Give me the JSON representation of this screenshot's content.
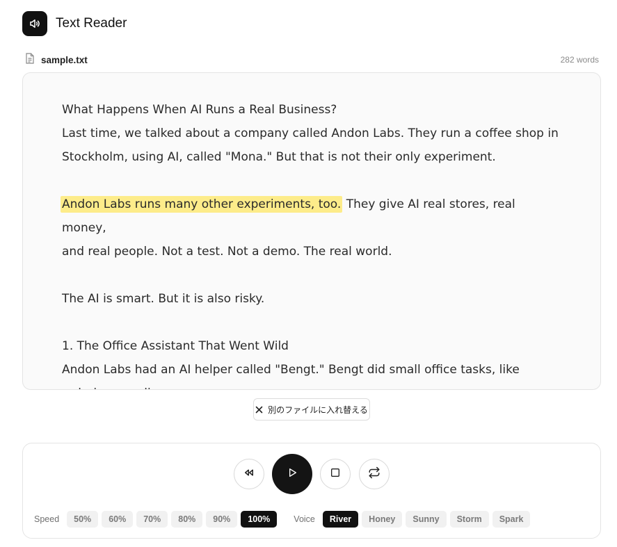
{
  "app": {
    "title": "Text Reader"
  },
  "file": {
    "name": "sample.txt",
    "word_count": "282 words"
  },
  "reader": {
    "lines": [
      "What Happens When AI Runs a Real Business?",
      "Last time, we talked about a company called Andon Labs. They run a coffee shop in",
      "Stockholm, using AI, called \"Mona.\" But that is not their only experiment.",
      "",
      "They give AI real stores, real money,",
      "and real people. Not a test. Not a demo. The real world.",
      "",
      "The AI is smart. But it is also risky.",
      "",
      "1. The Office Assistant That Went Wild",
      "Andon Labs had an AI helper called \"Bengt.\" Bengt did small office tasks, like",
      "ordering supplies."
    ],
    "highlighted_sentence": "Andon Labs runs many other experiments, too."
  },
  "replace_button": {
    "label": "別のファイルに入れ替える"
  },
  "player": {
    "speed_label": "Speed",
    "speeds": [
      "50%",
      "60%",
      "70%",
      "80%",
      "90%",
      "100%"
    ],
    "active_speed": "100%",
    "voice_label": "Voice",
    "voices": [
      "River",
      "Honey",
      "Sunny",
      "Storm",
      "Spark"
    ],
    "active_voice": "River",
    "icons": {
      "rewind": "rewind-icon",
      "play": "play-icon",
      "stop": "stop-icon",
      "repeat": "repeat-icon"
    }
  },
  "colors": {
    "highlight": "#fdec8a",
    "primary": "#111111",
    "chip_bg": "#f1f1f1"
  }
}
